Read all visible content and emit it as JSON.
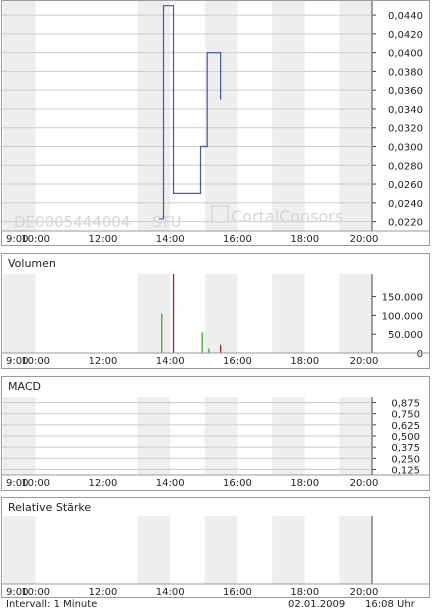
{
  "watermark": {
    "isin": "DE0005444004",
    "exchange": "STU",
    "brand": "CortalConsors"
  },
  "time_labels": [
    "9:00",
    "10:00",
    "12:00",
    "14:00",
    "16:00",
    "18:00",
    "20:00"
  ],
  "panels": {
    "volume": {
      "title": "Volumen"
    },
    "macd": {
      "title": "MACD"
    },
    "rsi": {
      "title": "Relative Stärke"
    }
  },
  "footer": {
    "interval": "Intervall: 1 Minute",
    "date": "02.01.2009",
    "time": "16:08 Uhr"
  },
  "colors": {
    "price_line": "#4a5a9a",
    "volume_up": "#33aa33",
    "volume_down": "#aa2222",
    "band": "#eeeeee",
    "grid": "#cccccc"
  },
  "chart_data": [
    {
      "type": "line",
      "title": "",
      "x_unit": "time of day (hours)",
      "xlim": [
        9,
        20
      ],
      "x_ticks": [
        "9:00",
        "10:00",
        "12:00",
        "14:00",
        "16:00",
        "18:00",
        "20:00"
      ],
      "ylim": [
        0.021,
        0.0455
      ],
      "y_ticks": [
        "0,0220",
        "0,0240",
        "0,0260",
        "0,0280",
        "0,0300",
        "0,0320",
        "0,0340",
        "0,0360",
        "0,0380",
        "0,0400",
        "0,0420",
        "0,0440"
      ],
      "series": [
        {
          "points": [
            [
              13.67,
              0.0223
            ],
            [
              13.8,
              0.0223
            ],
            [
              13.8,
              0.045
            ],
            [
              14.1,
              0.045
            ],
            [
              14.1,
              0.025
            ],
            [
              14.9,
              0.025
            ],
            [
              14.9,
              0.03
            ],
            [
              15.1,
              0.03
            ],
            [
              15.1,
              0.04
            ],
            [
              15.5,
              0.04
            ],
            [
              15.5,
              0.035
            ]
          ]
        }
      ]
    },
    {
      "type": "bar",
      "title": "Volumen",
      "xlim": [
        9,
        20
      ],
      "ylim": [
        0,
        210000
      ],
      "y_ticks": [
        "0",
        "50.000",
        "100.000",
        "150.000"
      ],
      "bars": [
        {
          "x": 13.75,
          "value": 105000,
          "direction": "up"
        },
        {
          "x": 14.1,
          "value": 210000,
          "direction": "down"
        },
        {
          "x": 14.95,
          "value": 55000,
          "direction": "up"
        },
        {
          "x": 15.15,
          "value": 12000,
          "direction": "up"
        },
        {
          "x": 15.5,
          "value": 22000,
          "direction": "down"
        }
      ]
    },
    {
      "type": "line",
      "title": "MACD",
      "xlim": [
        9,
        20
      ],
      "ylim": [
        0.0625,
        0.9375
      ],
      "y_ticks": [
        "0,875",
        "0,750",
        "0,625",
        "0,500",
        "0,375",
        "0,250",
        "0,125"
      ],
      "series": []
    },
    {
      "type": "line",
      "title": "Relative Stärke",
      "xlim": [
        9,
        20
      ],
      "ylim": [
        0,
        100
      ],
      "y_ticks": [],
      "series": []
    }
  ]
}
